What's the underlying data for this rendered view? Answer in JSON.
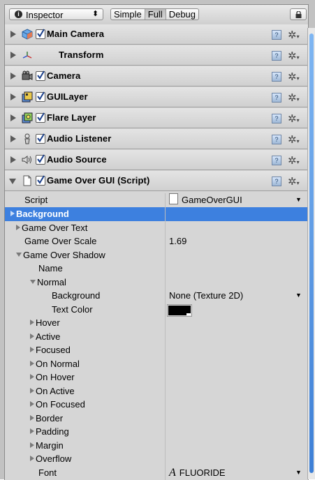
{
  "toolbar": {
    "window_label": "Inspector",
    "modes": [
      "Simple",
      "Full",
      "Debug"
    ],
    "active_mode": "Full"
  },
  "components": [
    {
      "name": "Main Camera",
      "icon": "gameobject-cube-icon",
      "checked": true
    },
    {
      "name": "Transform",
      "icon": "transform-axes-icon",
      "checked": null
    },
    {
      "name": "Camera",
      "icon": "camera-icon",
      "checked": true
    },
    {
      "name": "GUILayer",
      "icon": "guilayer-icon",
      "checked": true
    },
    {
      "name": "Flare Layer",
      "icon": "flarelayer-icon",
      "checked": true
    },
    {
      "name": "Audio Listener",
      "icon": "audio-listener-icon",
      "checked": true
    },
    {
      "name": "Audio Source",
      "icon": "audio-source-icon",
      "checked": true
    },
    {
      "name": "Game Over GUI (Script)",
      "icon": "script-document-icon",
      "checked": true,
      "expanded": true
    }
  ],
  "properties": [
    {
      "label": "Script",
      "value": "GameOverGUI"
    },
    {
      "label": "Background",
      "value": ""
    },
    {
      "label": "Game Over Text",
      "value": ""
    },
    {
      "label": "Game Over Scale",
      "value": "1.69"
    },
    {
      "label": "Game Over Shadow",
      "value": ""
    },
    {
      "label": "Name",
      "value": ""
    },
    {
      "label": "Normal",
      "value": ""
    },
    {
      "label": "Background",
      "value": "None (Texture 2D)"
    },
    {
      "label": "Text Color",
      "value": ""
    },
    {
      "label": "Hover",
      "value": ""
    },
    {
      "label": "Active",
      "value": ""
    },
    {
      "label": "Focused",
      "value": ""
    },
    {
      "label": "On Normal",
      "value": ""
    },
    {
      "label": "On Hover",
      "value": ""
    },
    {
      "label": "On Active",
      "value": ""
    },
    {
      "label": "On Focused",
      "value": ""
    },
    {
      "label": "Border",
      "value": ""
    },
    {
      "label": "Padding",
      "value": ""
    },
    {
      "label": "Margin",
      "value": ""
    },
    {
      "label": "Overflow",
      "value": ""
    },
    {
      "label": "Font",
      "value": "FLUORIDE"
    }
  ],
  "colors": {
    "selection": "#3d80df",
    "panel": "#d6d6d6",
    "text_color_swatch": "#000000"
  }
}
